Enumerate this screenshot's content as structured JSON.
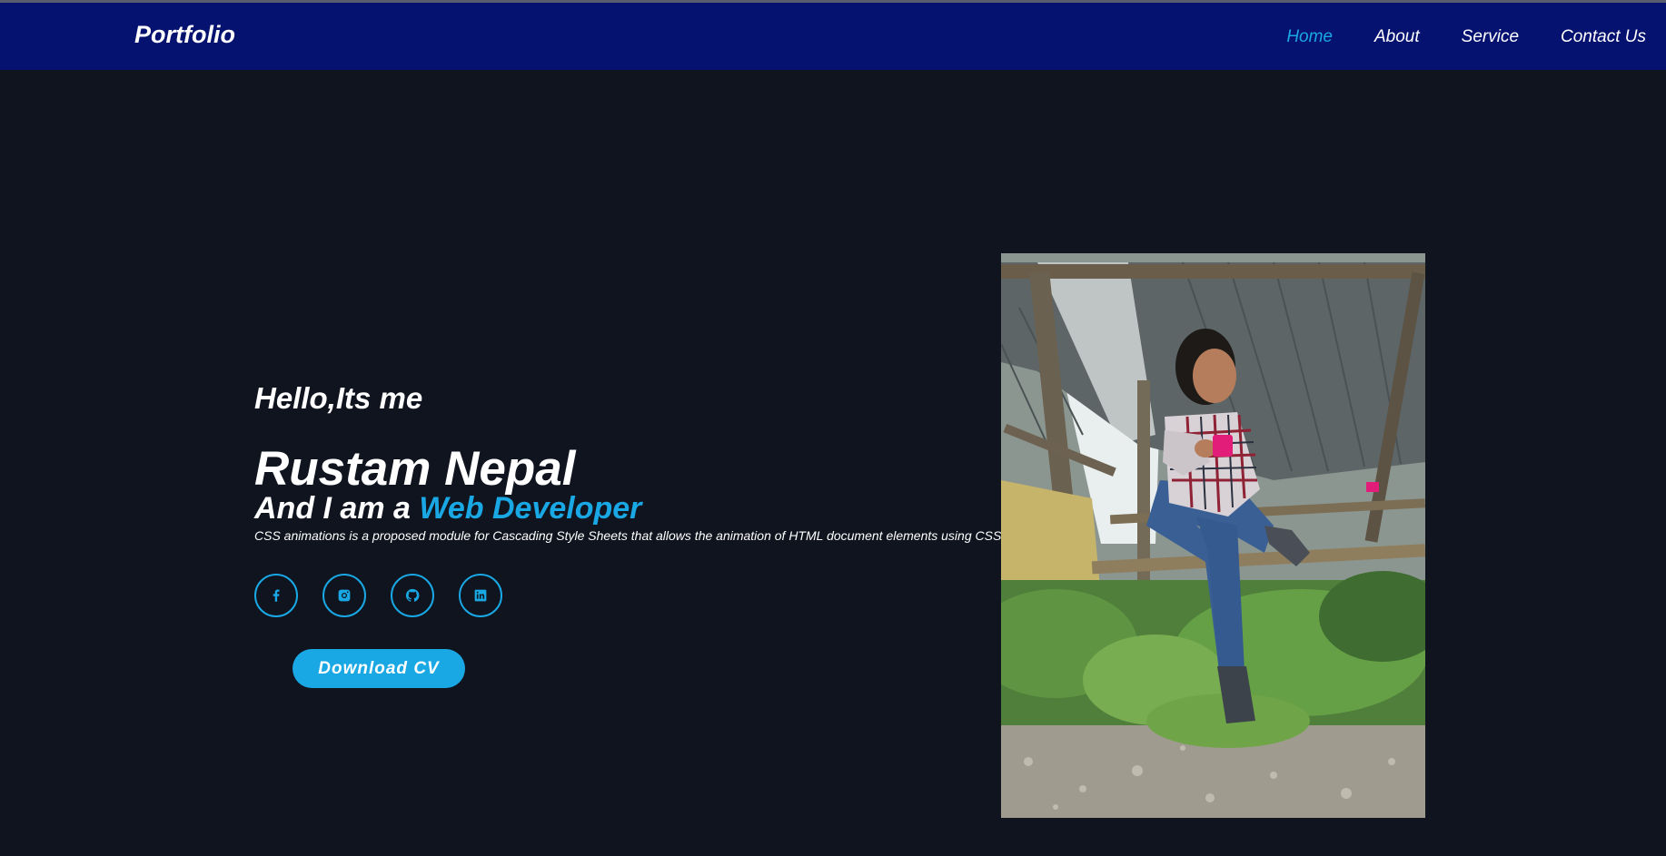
{
  "header": {
    "logo": "Portfolio",
    "nav": [
      {
        "label": "Home",
        "active": true
      },
      {
        "label": "About",
        "active": false
      },
      {
        "label": "Service",
        "active": false
      },
      {
        "label": "Contact Us",
        "active": false
      }
    ]
  },
  "hero": {
    "greeting": "Hello,Its me",
    "name": "Rustam Nepal",
    "role_prefix": "And I am a ",
    "role_highlight": "Web Developer",
    "description": "CSS animations is a proposed module for Cascading Style Sheets that allows the animation of HTML document elements using CSS.",
    "socials": [
      {
        "icon": "facebook-icon"
      },
      {
        "icon": "instagram-icon"
      },
      {
        "icon": "github-icon"
      },
      {
        "icon": "linkedin-icon"
      }
    ],
    "cv_button": "Download CV"
  },
  "colors": {
    "navbar": "#061270",
    "background": "#0f141f",
    "accent": "#1aa8e5",
    "text": "#ffffff"
  }
}
